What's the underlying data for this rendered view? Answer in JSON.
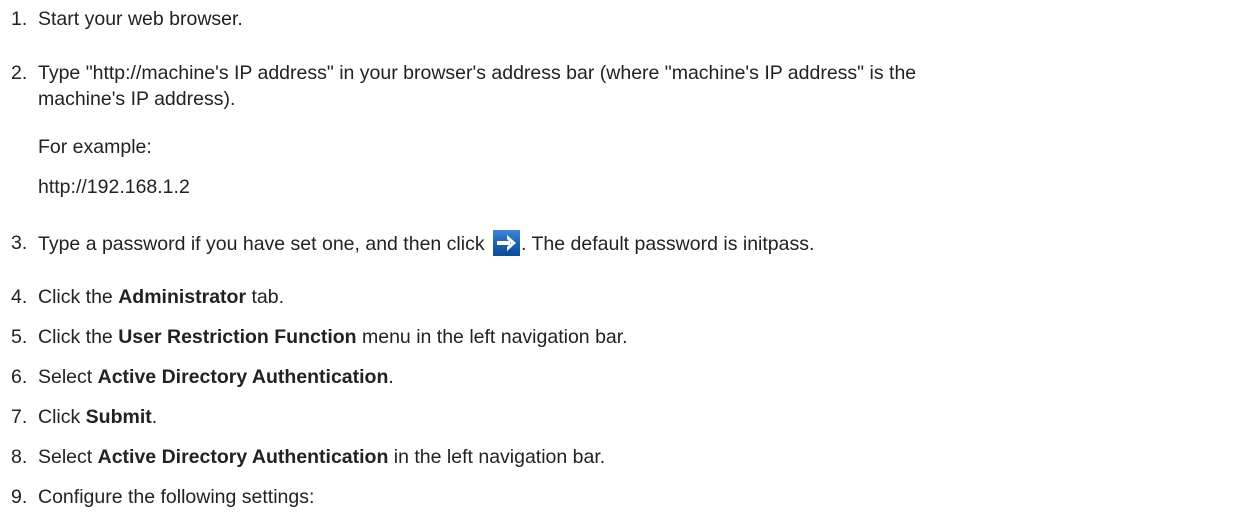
{
  "steps": [
    {
      "num": "1.",
      "text": "Start your web browser."
    },
    {
      "num": "2.",
      "line1": "Type \"http://machine's IP address\" in your browser's address bar (where \"machine's IP address\" is the",
      "line2": "machine's IP address).",
      "example_label": "For example:",
      "example_value": "http://192.168.1.2"
    },
    {
      "num": "3.",
      "before_icon": "Type a password if you have set one, and then click ",
      "icon": "arrow-right-icon",
      "after_icon": ". The default password is initpass."
    },
    {
      "num": "4.",
      "pre": "Click the ",
      "bold": "Administrator",
      "post": " tab."
    },
    {
      "num": "5.",
      "pre": "Click the ",
      "bold": "User Restriction Function",
      "post": " menu in the left navigation bar."
    },
    {
      "num": "6.",
      "pre": "Select ",
      "bold": "Active Directory Authentication",
      "post": "."
    },
    {
      "num": "7.",
      "pre": "Click ",
      "bold": "Submit",
      "post": "."
    },
    {
      "num": "8.",
      "pre": "Select ",
      "bold": "Active Directory Authentication",
      "post": " in the left navigation bar."
    },
    {
      "num": "9.",
      "text": "Configure the following settings:"
    }
  ],
  "colors": {
    "text": "#222222",
    "icon_bg": "#1b63b6",
    "icon_arrow": "#ffffff"
  }
}
